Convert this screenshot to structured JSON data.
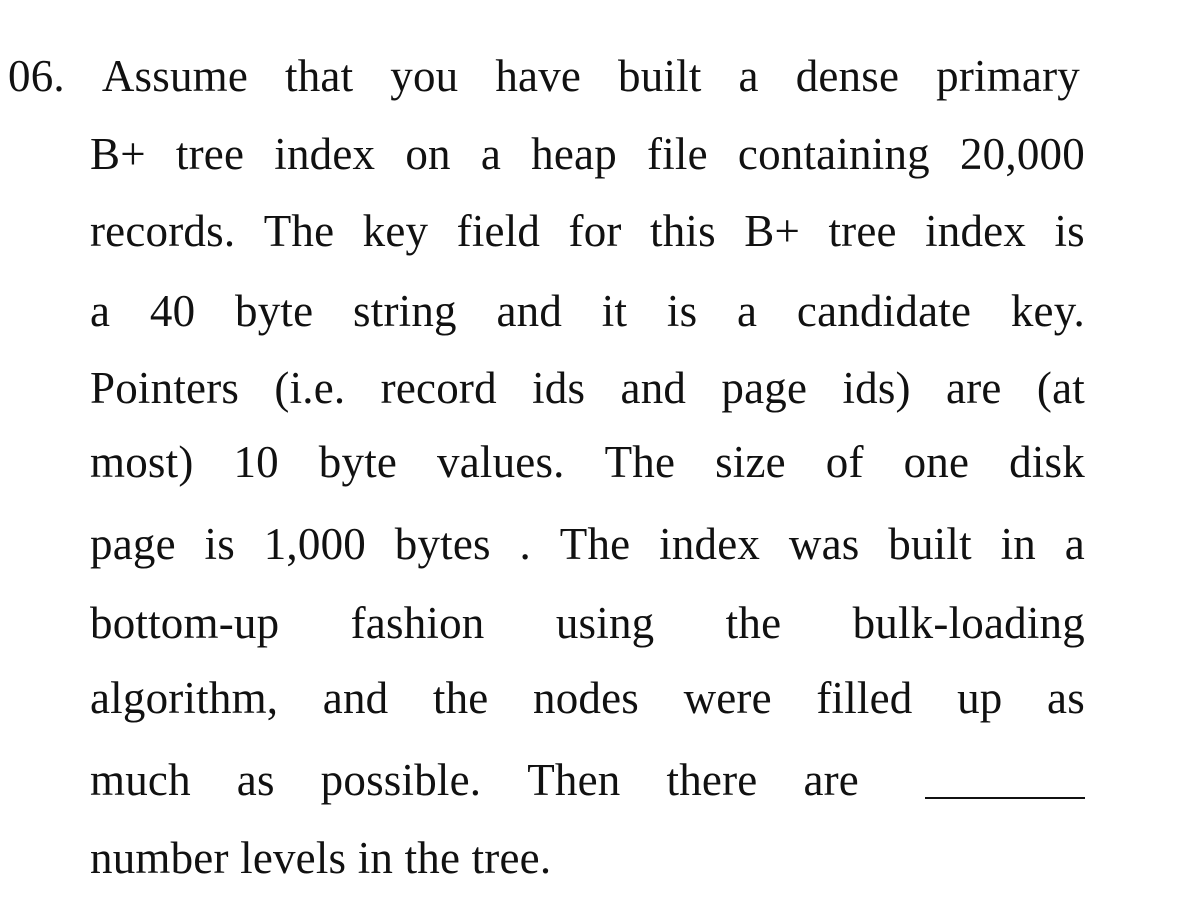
{
  "question": {
    "number": "06.",
    "lines": [
      "06. Assume that you have built a dense primary",
      "B+ tree index on a heap file containing 20,000",
      "records. The key field for this B+ tree index is",
      "a 40 byte string and it is a candidate key.",
      "Pointers (i.e. record ids and page ids) are (at",
      "most) 10 byte values. The size of one disk",
      "page is 1,000 bytes . The index was built in a",
      "bottom-up fashion using the bulk-loading",
      "algorithm, and the nodes were filled up as",
      "much as possible. Then there are",
      "number levels in the tree."
    ],
    "answer_blank": ""
  }
}
